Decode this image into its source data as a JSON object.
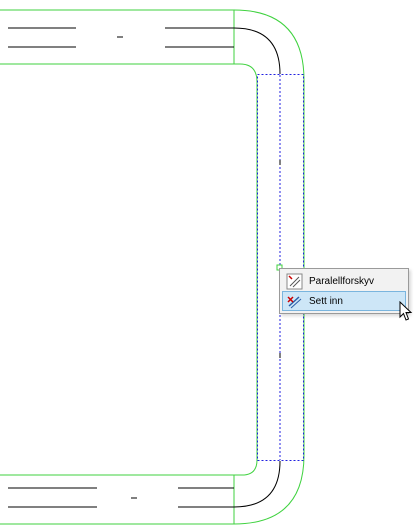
{
  "context_menu": {
    "items": [
      {
        "label": "Paralellforskyv",
        "icon": "parallel-shift-icon",
        "selected": false
      },
      {
        "label": "Sett inn",
        "icon": "insert-vertex-icon",
        "selected": true
      }
    ]
  },
  "colors": {
    "road_edge": "#3fd23f",
    "centerline": "#000000",
    "selection_outline": "#2020e0",
    "menu_highlight": "#cde6f7",
    "menu_highlight_border": "#7ab5de"
  },
  "icons": [
    "mouse-pointer-icon",
    "grip-handle-icon"
  ]
}
